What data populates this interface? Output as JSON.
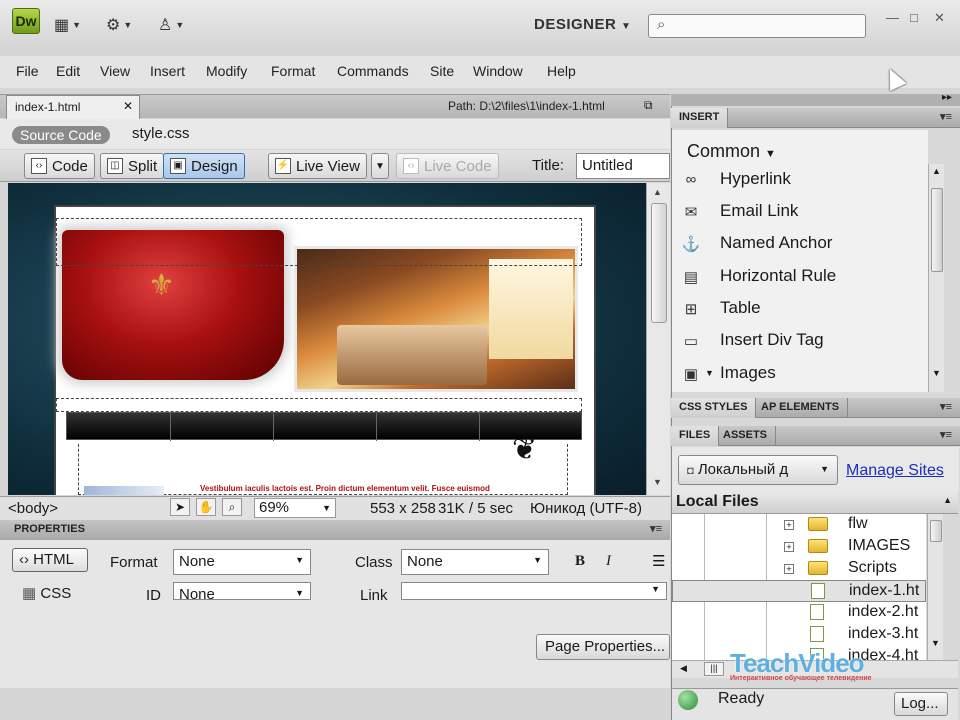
{
  "app": {
    "logo": "Dw",
    "workspace": "DESIGNER"
  },
  "menu": [
    "File",
    "Edit",
    "View",
    "Insert",
    "Modify",
    "Format",
    "Commands",
    "Site",
    "Window",
    "Help"
  ],
  "document": {
    "tab": "index-1.html",
    "path": "Path:  D:\\2\\files\\1\\index-1.html",
    "source_code": "Source Code",
    "related_file": "style.css",
    "views": {
      "code": "Code",
      "split": "Split",
      "design": "Design",
      "live_view": "Live View",
      "live_code": "Live Code"
    },
    "title_label": "Title:",
    "title_value": "Untitled",
    "preview_text": "Vestibulum iaculis lactois est. Proin dictum elementum velit. Fusce euismod"
  },
  "status": {
    "tag": "<body>",
    "zoom": "69%",
    "size": "553 x 258",
    "download": "31K / 5 sec",
    "encoding": "Юникод (UTF-8)"
  },
  "properties": {
    "header": "PROPERTIES",
    "html_btn": "HTML",
    "css_btn": "CSS",
    "format_label": "Format",
    "format_value": "None",
    "id_label": "ID",
    "id_value": "None",
    "class_label": "Class",
    "class_value": "None",
    "link_label": "Link",
    "bold": "B",
    "italic": "I",
    "page_props": "Page Properties..."
  },
  "insert_panel": {
    "header": "INSERT",
    "category": "Common",
    "items": [
      {
        "label": "Hyperlink",
        "icon": "link-icon"
      },
      {
        "label": "Email Link",
        "icon": "email-icon"
      },
      {
        "label": "Named Anchor",
        "icon": "anchor-icon"
      },
      {
        "label": "Horizontal Rule",
        "icon": "horizontal-rule-icon"
      },
      {
        "label": "Table",
        "icon": "table-icon"
      },
      {
        "label": "Insert Div Tag",
        "icon": "div-tag-icon"
      },
      {
        "label": "Images",
        "icon": "image-icon"
      }
    ]
  },
  "css_panel": {
    "tab1": "CSS STYLES",
    "tab2": "AP ELEMENTS"
  },
  "files_panel": {
    "tab1": "FILES",
    "tab2": "ASSETS",
    "site": "Локальный д",
    "manage": "Manage Sites",
    "local_files": "Local Files",
    "entries": [
      {
        "name": "flw",
        "type": "folder"
      },
      {
        "name": "IMAGES",
        "type": "folder"
      },
      {
        "name": "Scripts",
        "type": "folder"
      },
      {
        "name": "index-1.ht",
        "type": "file"
      },
      {
        "name": "index-2.ht",
        "type": "file"
      },
      {
        "name": "index-3.ht",
        "type": "file"
      },
      {
        "name": "index-4.ht",
        "type": "file"
      }
    ],
    "ready": "Ready",
    "log": "Log..."
  },
  "watermark": {
    "brand": "TeachVideo",
    "tagline": "Интерактивное обучающее телевидение"
  },
  "colors": {
    "accent": "#3b6ea5",
    "link": "#1a2fb8",
    "dw_logo": "#8cc63f"
  }
}
